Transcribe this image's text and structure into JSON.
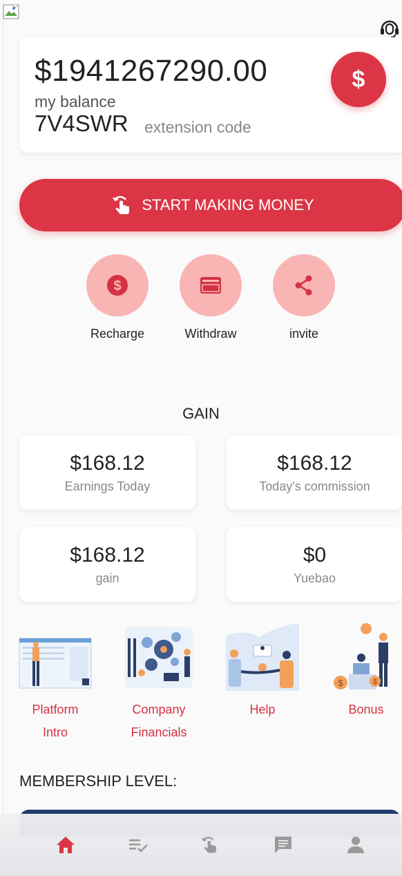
{
  "header": {
    "broken_image_icon": "broken-image-icon",
    "support_icon": "headset-icon"
  },
  "balance": {
    "amount": "$1941267290.00",
    "label": "my balance",
    "code": "7V4SWR",
    "code_label": "extension code",
    "action_icon": "dollar-icon",
    "action_symbol": "$"
  },
  "start_button": {
    "label": "START MAKING MONEY",
    "icon": "hand-tap-icon"
  },
  "actions": [
    {
      "label": "Recharge",
      "icon": "dollar-coin-icon"
    },
    {
      "label": "Withdraw",
      "icon": "credit-card-icon"
    },
    {
      "label": "invite",
      "icon": "share-icon"
    }
  ],
  "gain": {
    "title": "GAIN",
    "stats": [
      {
        "value": "$168.12",
        "caption": "Earnings Today"
      },
      {
        "value": "$168.12",
        "caption": "Today's commission"
      },
      {
        "value": "$168.12",
        "caption": "gain"
      },
      {
        "value": "$0",
        "caption": "Yuebao"
      }
    ]
  },
  "features": [
    {
      "label": "Platform Intro",
      "line1": "Platform",
      "line2": "Intro"
    },
    {
      "label": "Company Financials",
      "line1": "Company",
      "line2": "Financials"
    },
    {
      "label": "Help",
      "line1": "Help",
      "line2": ""
    },
    {
      "label": "Bonus",
      "line1": "Bonus",
      "line2": ""
    }
  ],
  "membership": {
    "title": "MEMBERSHIP LEVEL:"
  },
  "tabbar": [
    {
      "icon": "home-icon",
      "active": true
    },
    {
      "icon": "task-list-icon",
      "active": false
    },
    {
      "icon": "hand-tap-icon",
      "active": false
    },
    {
      "icon": "message-icon",
      "active": false
    },
    {
      "icon": "user-icon",
      "active": false
    }
  ],
  "colors": {
    "accent": "#dc3545",
    "accent_light": "#f9b4b4",
    "feature_text": "#d33342",
    "tab_inactive": "#9a9a9a"
  }
}
